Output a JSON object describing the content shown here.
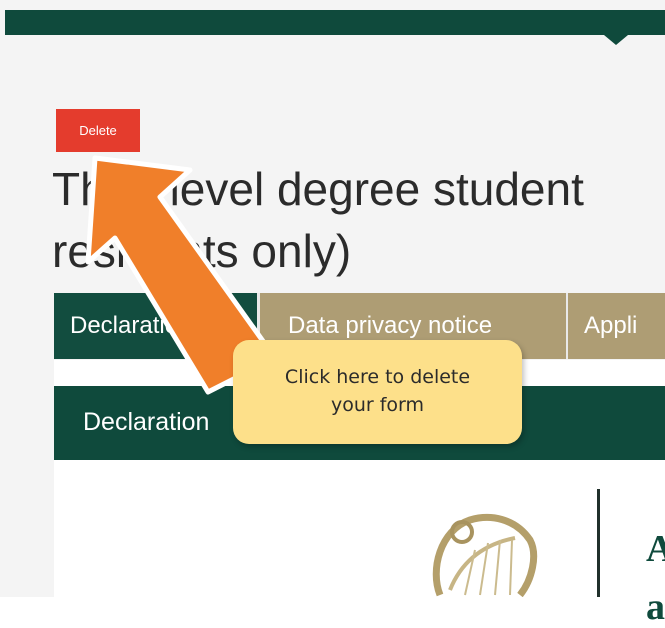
{
  "toolbar": {
    "delete_label": "Delete"
  },
  "title": {
    "line1": "Third level degree student",
    "line2": "residents only)"
  },
  "tabs": [
    {
      "label": "Declaration",
      "active": true
    },
    {
      "label": "Data privacy notice",
      "active": false
    },
    {
      "label": "Appli",
      "active": false
    }
  ],
  "panel": {
    "header": "Declaration"
  },
  "callout": {
    "line1": "Click here to delete",
    "line2": "your form"
  },
  "partial_text": {
    "line1": "A",
    "line2": "a"
  },
  "colors": {
    "primary_green": "#0f4a3c",
    "tab_tan": "#ae9d74",
    "delete_red": "#e43c2d",
    "arrow_orange": "#f07f2a",
    "callout_yellow": "#fde08a"
  },
  "icons": {
    "emblem": "harp-icon",
    "pointer": "arrow-icon"
  }
}
